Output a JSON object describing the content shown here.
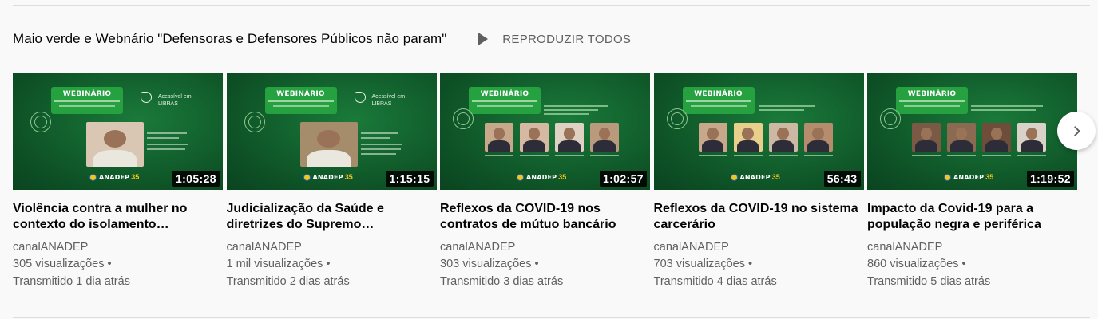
{
  "shelf": {
    "title": "Maio verde e Webnário \"Defensoras e Defensores Públicos não param\"",
    "play_all_label": "REPRODUZIR TODOS",
    "play_all_icon": "play-icon",
    "next_icon": "chevron-right-icon"
  },
  "thumbnail_common": {
    "webinar_title": "WEBINÁRIO",
    "libras_line1": "Acessível em",
    "libras_line2": "LIBRAS",
    "logo_text": "ANADEP",
    "logo_number": "35",
    "brand_green": "#0f5b2a"
  },
  "videos": [
    {
      "title": "Violência contra a mulher no contexto do isolamento…",
      "channel": "canalANADEP",
      "views": "305 visualizações",
      "streamed": "Transmitido 1 dia atrás",
      "duration": "1:05:28"
    },
    {
      "title": "Judicialização da Saúde e diretrizes do Supremo…",
      "channel": "canalANADEP",
      "views": "1 mil visualizações",
      "streamed": "Transmitido 2 dias atrás",
      "duration": "1:15:15"
    },
    {
      "title": "Reflexos da COVID-19 nos contratos de mútuo bancário",
      "channel": "canalANADEP",
      "views": "303 visualizações",
      "streamed": "Transmitido 3 dias atrás",
      "duration": "1:02:57"
    },
    {
      "title": "Reflexos da COVID-19 no sistema carcerário",
      "channel": "canalANADEP",
      "views": "703 visualizações",
      "streamed": "Transmitido 4 dias atrás",
      "duration": "56:43"
    },
    {
      "title": "Impacto da Covid-19 para a população negra e periférica",
      "channel": "canalANADEP",
      "views": "860 visualizações",
      "streamed": "Transmitido 5 dias atrás",
      "duration": "1:19:52"
    }
  ],
  "separator": "•"
}
